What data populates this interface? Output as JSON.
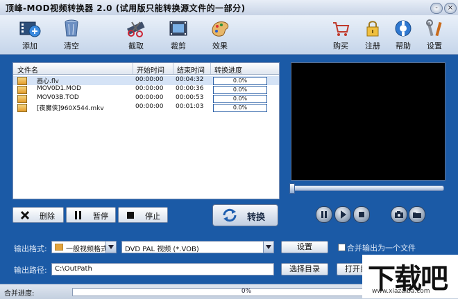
{
  "window": {
    "title": "顶峰-MOD视频转换器 2.0 (试用版只能转换源文件的一部分)",
    "controls": [
      "-",
      "×"
    ]
  },
  "toolbar": {
    "left": [
      {
        "label": "添加",
        "icon": "add-video-icon"
      },
      {
        "label": "清空",
        "icon": "clear-bin-icon"
      },
      {
        "label": "截取",
        "icon": "scissors-icon"
      },
      {
        "label": "裁剪",
        "icon": "crop-film-icon"
      },
      {
        "label": "效果",
        "icon": "effects-palette-icon"
      }
    ],
    "right": [
      {
        "label": "购买",
        "icon": "cart-icon"
      },
      {
        "label": "注册",
        "icon": "lock-icon"
      },
      {
        "label": "帮助",
        "icon": "help-icon"
      },
      {
        "label": "设置",
        "icon": "tools-icon"
      }
    ]
  },
  "file_list": {
    "columns": [
      "文件名",
      "开始时间",
      "结束时间",
      "转换进度"
    ],
    "rows": [
      {
        "name": "画心.flv",
        "start": "00:00:00",
        "end": "00:04:32",
        "progress": "0.0%",
        "selected": true
      },
      {
        "name": "MOV0D1.MOD",
        "start": "00:00:00",
        "end": "00:00:36",
        "progress": "0.0%",
        "selected": false
      },
      {
        "name": "MOV03B.TOD",
        "start": "00:00:00",
        "end": "00:00:53",
        "progress": "0.0%",
        "selected": false
      },
      {
        "name": "[夜魔侠]960X544.mkv",
        "start": "00:00:00",
        "end": "00:01:03",
        "progress": "0.0%",
        "selected": false
      }
    ]
  },
  "actions": {
    "delete": "删除",
    "pause": "暂停",
    "stop": "停止",
    "convert": "转换"
  },
  "output": {
    "format_label": "输出格式:",
    "format_category": "一般视频格式",
    "format_value": "DVD PAL 视频  (*.VOB)",
    "settings_button": "设置",
    "merge_label": "合并输出为一个文件",
    "merge_checked": false,
    "path_label": "输出路径:",
    "path_value": "C:\\OutPath",
    "choose_dir_button": "选择目录",
    "open_dir_button": "打开目录"
  },
  "status": {
    "merge_progress_label": "合并进度:",
    "merge_progress": "0%"
  },
  "watermark": {
    "text": "下载吧",
    "url": "www.xiazaiba.com"
  },
  "colors": {
    "frame": "#1b5aa6",
    "toolbar_bg": "#dbe5f2",
    "selection": "#d5e3f6",
    "preview_bg": "#000000"
  }
}
